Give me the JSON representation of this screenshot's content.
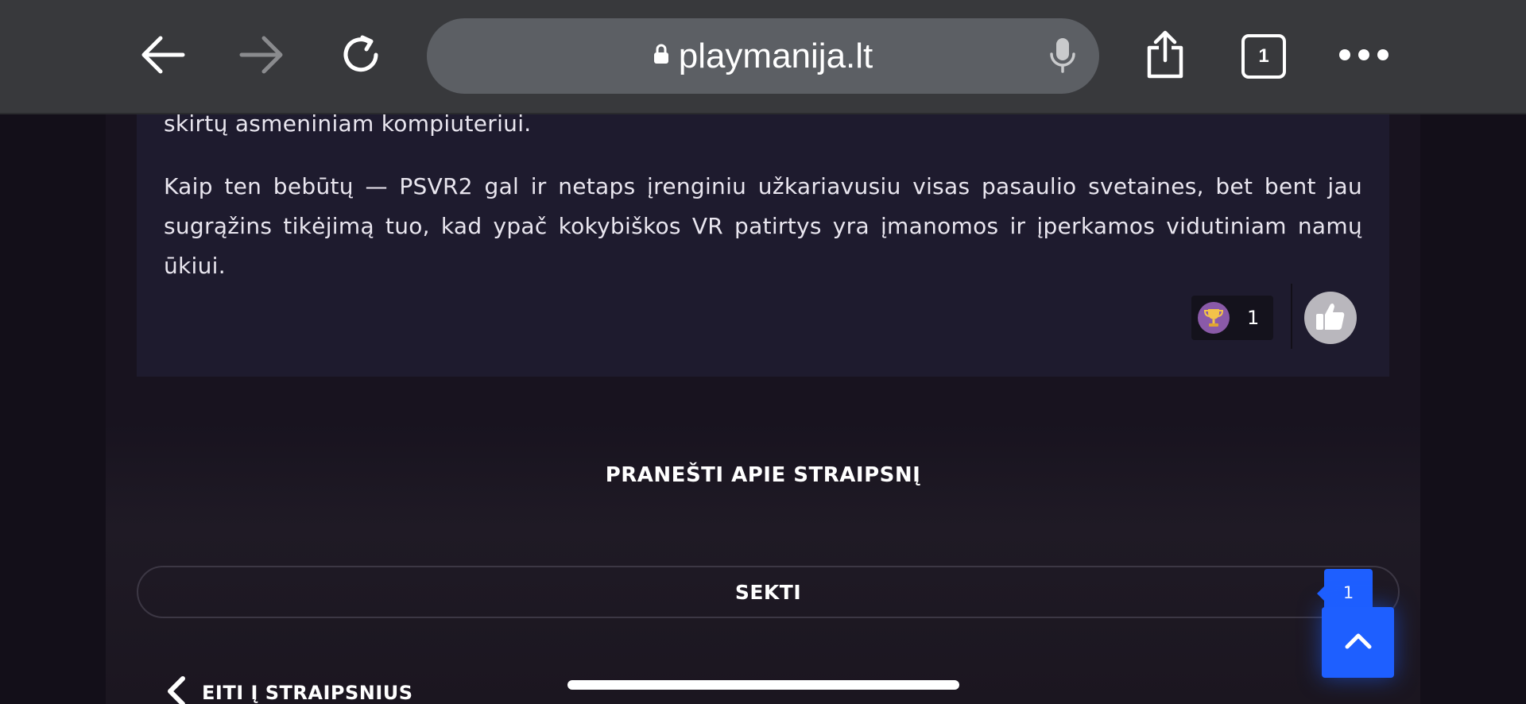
{
  "browser": {
    "url": "playmanija.lt",
    "tab_count": "1"
  },
  "article": {
    "previous_line": "skirtų asmeniniam kompiuteriui.",
    "closing_paragraph": "Kaip ten bebūtų — PSVR2 gal ir netaps įrenginiu užkariavusiu visas pasaulio svetaines, bet bent jau sugrąžins tikėjimą tuo, kad ypač kokybiškos VR patirtys yra įmanomos ir įperkamos vidutiniam namų ūkiui.",
    "reward_count": "1"
  },
  "actions": {
    "report_label": "PRANEŠTI APIE STRAIPSNĮ",
    "follow_label": "SEKTI",
    "follow_count": "1",
    "back_label": "EITI Į STRAIPSNIUS"
  },
  "icons": {
    "back": "arrow-left-icon",
    "forward": "arrow-right-icon",
    "reload": "reload-icon",
    "lock": "lock-icon",
    "mic": "microphone-icon",
    "share": "share-icon",
    "more": "more-dots-icon",
    "trophy": "trophy-icon",
    "like": "thumbs-up-icon",
    "scroll_top": "chevron-up-icon"
  },
  "colors": {
    "accent": "#1e5fff",
    "card_background": "#1e1b2e",
    "page_background": "#130f19",
    "browser_bar": "#38393c"
  }
}
